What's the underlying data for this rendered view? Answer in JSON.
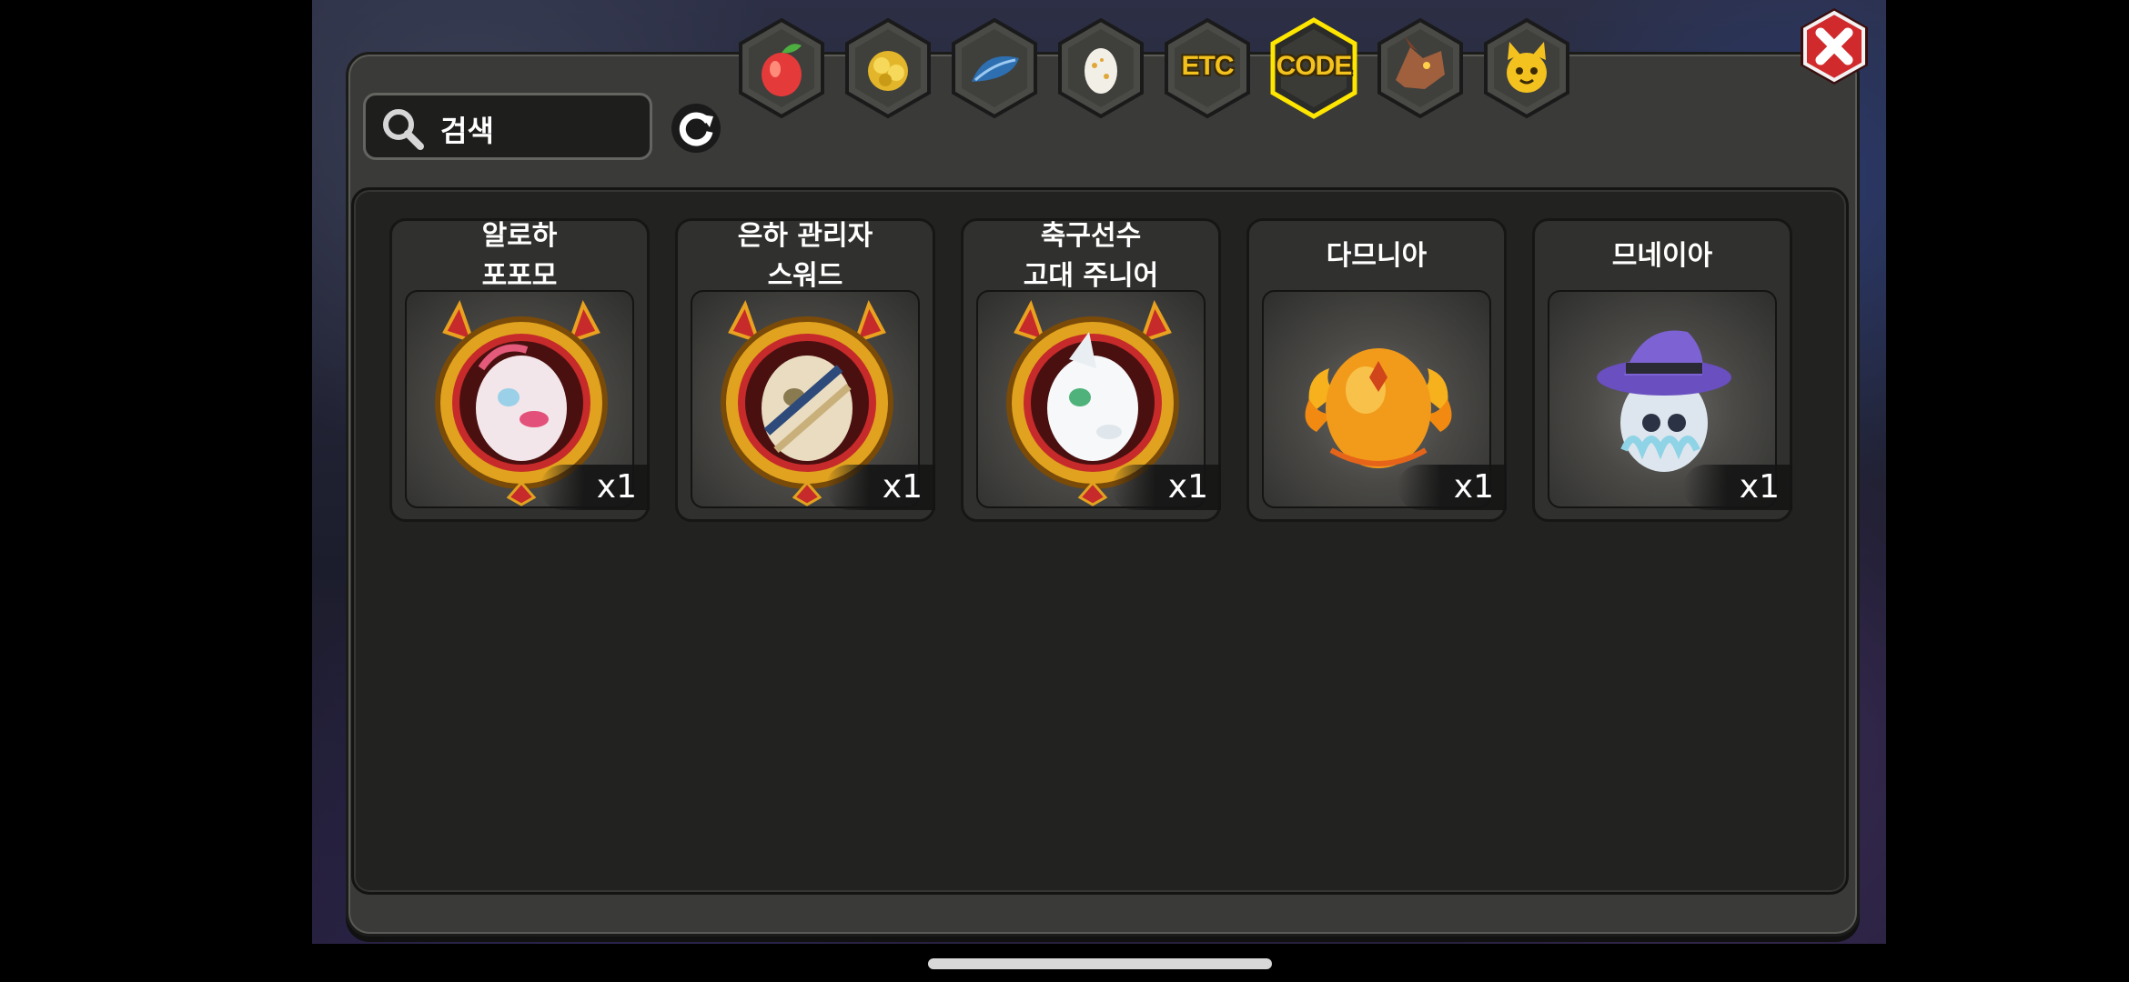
{
  "search": {
    "label": "검색"
  },
  "tabs": [
    {
      "name": "fruit",
      "icon": "fruit-icon",
      "text": "",
      "active": false
    },
    {
      "name": "gold",
      "icon": "gold-coin-icon",
      "text": "",
      "active": false
    },
    {
      "name": "feather",
      "icon": "feather-icon",
      "text": "",
      "active": false
    },
    {
      "name": "egg",
      "icon": "egg-icon",
      "text": "",
      "active": false
    },
    {
      "name": "etc",
      "icon": "",
      "text": "ETC",
      "active": false
    },
    {
      "name": "code",
      "icon": "",
      "text": "CODE",
      "active": true
    },
    {
      "name": "dragon",
      "icon": "dragon-head-icon",
      "text": "",
      "active": false
    },
    {
      "name": "cat",
      "icon": "cat-face-icon",
      "text": "",
      "active": false
    }
  ],
  "items": [
    {
      "name": "알로하\n포포모",
      "qty": "x1",
      "icon": "dragon-portrait-pink"
    },
    {
      "name": "은하 관리자\n스워드",
      "qty": "x1",
      "icon": "dragon-portrait-gold"
    },
    {
      "name": "축구선수\n고대 주니어",
      "qty": "x1",
      "icon": "dragon-portrait-white"
    },
    {
      "name": "다므니아",
      "qty": "x1",
      "icon": "fire-egg-icon"
    },
    {
      "name": "므네이아",
      "qty": "x1",
      "icon": "witch-hat-egg-icon"
    }
  ],
  "colors": {
    "accent": "#f4c21f",
    "close": "#c8282a",
    "panel": "#3a3a38"
  }
}
